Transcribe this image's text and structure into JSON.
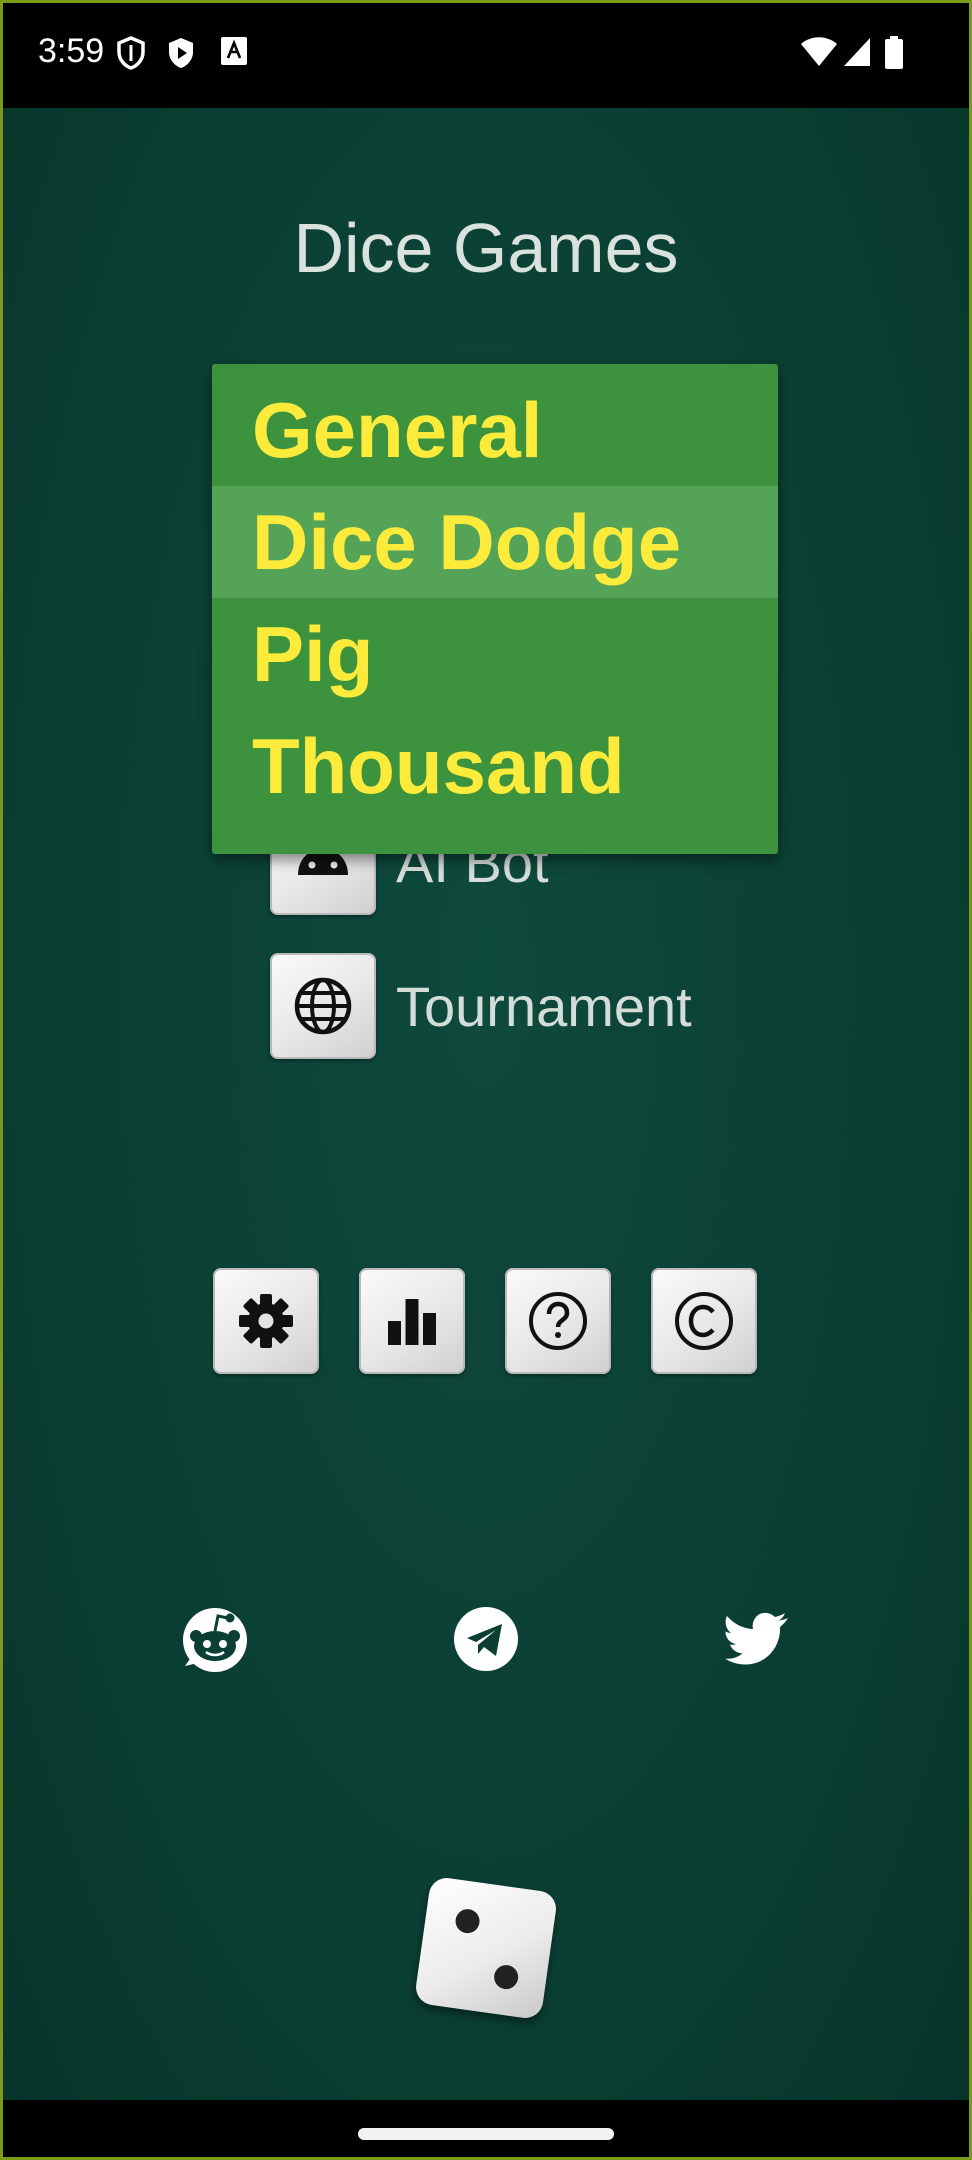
{
  "status_bar": {
    "time": "3:59",
    "icons": [
      "shield-icon",
      "play-protect-icon",
      "font-icon",
      "wifi-icon",
      "signal-icon",
      "battery-icon"
    ]
  },
  "app": {
    "title": "Dice Games"
  },
  "modes": [
    {
      "label": "AI Bot",
      "icon": "android-icon"
    },
    {
      "label": "Tournament",
      "icon": "globe-icon"
    }
  ],
  "dropdown": {
    "items": [
      "General",
      "Dice Dodge",
      "Pig",
      "Thousand"
    ],
    "highlighted": "Dice Dodge"
  },
  "tools": [
    {
      "icon": "gear-icon"
    },
    {
      "icon": "stats-icon"
    },
    {
      "icon": "help-icon"
    },
    {
      "icon": "copyright-icon"
    }
  ],
  "social": [
    {
      "icon": "reddit-icon"
    },
    {
      "icon": "telegram-icon"
    },
    {
      "icon": "twitter-icon"
    }
  ],
  "die": {
    "face": 2
  },
  "colors": {
    "background": "#0b3f33",
    "menu": "#3c923d",
    "menu_highlight": "#55a357",
    "menu_text": "#fdeb3c",
    "title_text": "#d9e2dd"
  }
}
